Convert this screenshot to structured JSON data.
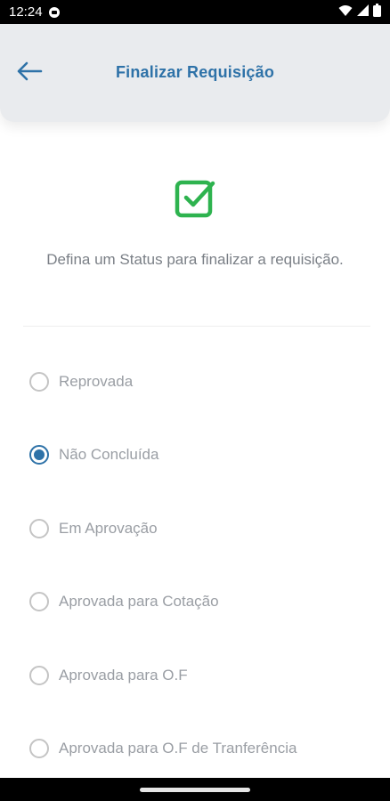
{
  "status_bar": {
    "time": "12:24"
  },
  "header": {
    "title": "Finalizar Requisição"
  },
  "main": {
    "instruction": "Defina um Status para finalizar a requisição.",
    "options": [
      {
        "label": "Reprovada",
        "checked": false
      },
      {
        "label": "Não Concluída",
        "checked": true
      },
      {
        "label": "Em Aprovação",
        "checked": false
      },
      {
        "label": "Aprovada para Cotação",
        "checked": false
      },
      {
        "label": "Aprovada para O.F",
        "checked": false
      },
      {
        "label": "Aprovada para O.F de Tranferência",
        "checked": false
      }
    ]
  },
  "colors": {
    "accent": "#2e72a8",
    "success": "#2eb34f",
    "header_bg": "#e9ebee",
    "muted_text": "#9a9ea4"
  }
}
